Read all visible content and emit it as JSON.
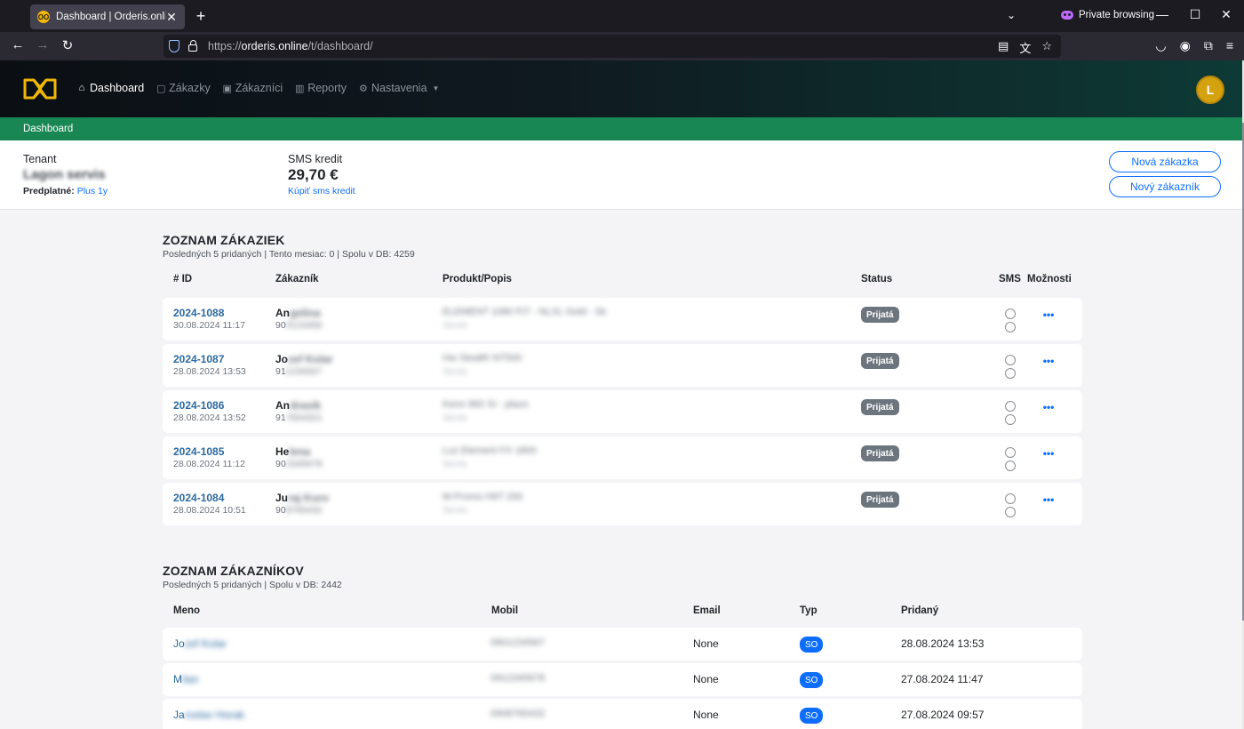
{
  "browser": {
    "tab_title": "Dashboard | Orderis.online",
    "favicon_text": "OO",
    "private_label": "Private browsing",
    "url_scheme": "https://",
    "url_host": "orderis.online",
    "url_path": "/t/dashboard/"
  },
  "nav": {
    "items": [
      {
        "label": "Dashboard",
        "icon": "home-icon",
        "active": true
      },
      {
        "label": "Zákazky",
        "icon": "document-icon"
      },
      {
        "label": "Zákazníci",
        "icon": "user-icon"
      },
      {
        "label": "Reporty",
        "icon": "chart-icon"
      },
      {
        "label": "Nastavenia",
        "icon": "gear-icon"
      }
    ],
    "avatar_letter": "L"
  },
  "breadcrumb": "Dashboard",
  "info": {
    "tenant_label": "Tenant",
    "tenant_name": "Lagon servis",
    "plan_label": "Predplatné:",
    "plan_value": "Plus 1y",
    "sms_label": "SMS kredit",
    "sms_value": "29,70 €",
    "sms_buy": "Kúpiť sms kredit",
    "btn_new_order": "Nová zákazka",
    "btn_new_customer": "Nový zákazník"
  },
  "orders": {
    "title": "ZOZNAM ZÁKAZIEK",
    "subtitle": "Posledných 5 pridaných | Tento mesiac: 0 | Spolu v DB: 4259",
    "headers": {
      "id": "# ID",
      "customer": "Zákazník",
      "product": "Produkt/Popis",
      "status": "Status",
      "sms": "SMS",
      "options": "Možnosti"
    },
    "rows": [
      {
        "id": "2024-1088",
        "date": "30.08.2024 11:17",
        "cust_visible": "An",
        "cust_blur": "gelina",
        "phone_visible": "90",
        "phone_blur": "0123456",
        "product": "ELEMENT 1080 FIT - NLXL Gold - Sk",
        "product2": "Servis",
        "status": "Prijatá"
      },
      {
        "id": "2024-1087",
        "date": "28.08.2024 13:53",
        "cust_visible": "Jo",
        "cust_blur": "zef Kolar",
        "phone_visible": "91",
        "phone_blur": "1234567",
        "product": "Hw Stealth NT500",
        "product2": "Servis",
        "status": "Prijatá"
      },
      {
        "id": "2024-1086",
        "date": "28.08.2024 13:52",
        "cust_visible": "An",
        "cust_blur": "drasik",
        "phone_visible": "91",
        "phone_blur": "7654321",
        "product": "Kenn 960 SI - plazo",
        "product2": "Servis",
        "status": "Prijatá"
      },
      {
        "id": "2024-1085",
        "date": "28.08.2024 11:12",
        "cust_visible": "He",
        "cust_blur": "lena",
        "phone_visible": "90",
        "phone_blur": "2345678",
        "product": "Luz Element FX 1800",
        "product2": "Servis",
        "status": "Prijatá"
      },
      {
        "id": "2024-1084",
        "date": "28.08.2024 10:51",
        "cust_visible": "Ju",
        "cust_blur": "raj Kuro",
        "phone_visible": "90",
        "phone_blur": "8765432",
        "product": "M-Promo H6T 200",
        "product2": "Servis",
        "status": "Prijatá"
      }
    ]
  },
  "customers": {
    "title": "ZOZNAM ZÁKAZNÍKOV",
    "subtitle": "Posledných 5 pridaných | Spolu v DB: 2442",
    "headers": {
      "name": "Meno",
      "mobile": "Mobil",
      "email": "Email",
      "type": "Typ",
      "added": "Pridaný"
    },
    "rows": [
      {
        "name_visible": "Jo",
        "name_blur": "zef Kolar",
        "mobile": "0901234567",
        "email": "None",
        "type": "SO",
        "added": "28.08.2024 13:53"
      },
      {
        "name_visible": "M",
        "name_blur": "ilan",
        "mobile": "0912345678",
        "email": "None",
        "type": "SO",
        "added": "27.08.2024 11:47"
      },
      {
        "name_visible": "Ja",
        "name_blur": "roslav Horak",
        "mobile": "0908765432",
        "email": "None",
        "type": "SO",
        "added": "27.08.2024 09:57"
      }
    ]
  }
}
